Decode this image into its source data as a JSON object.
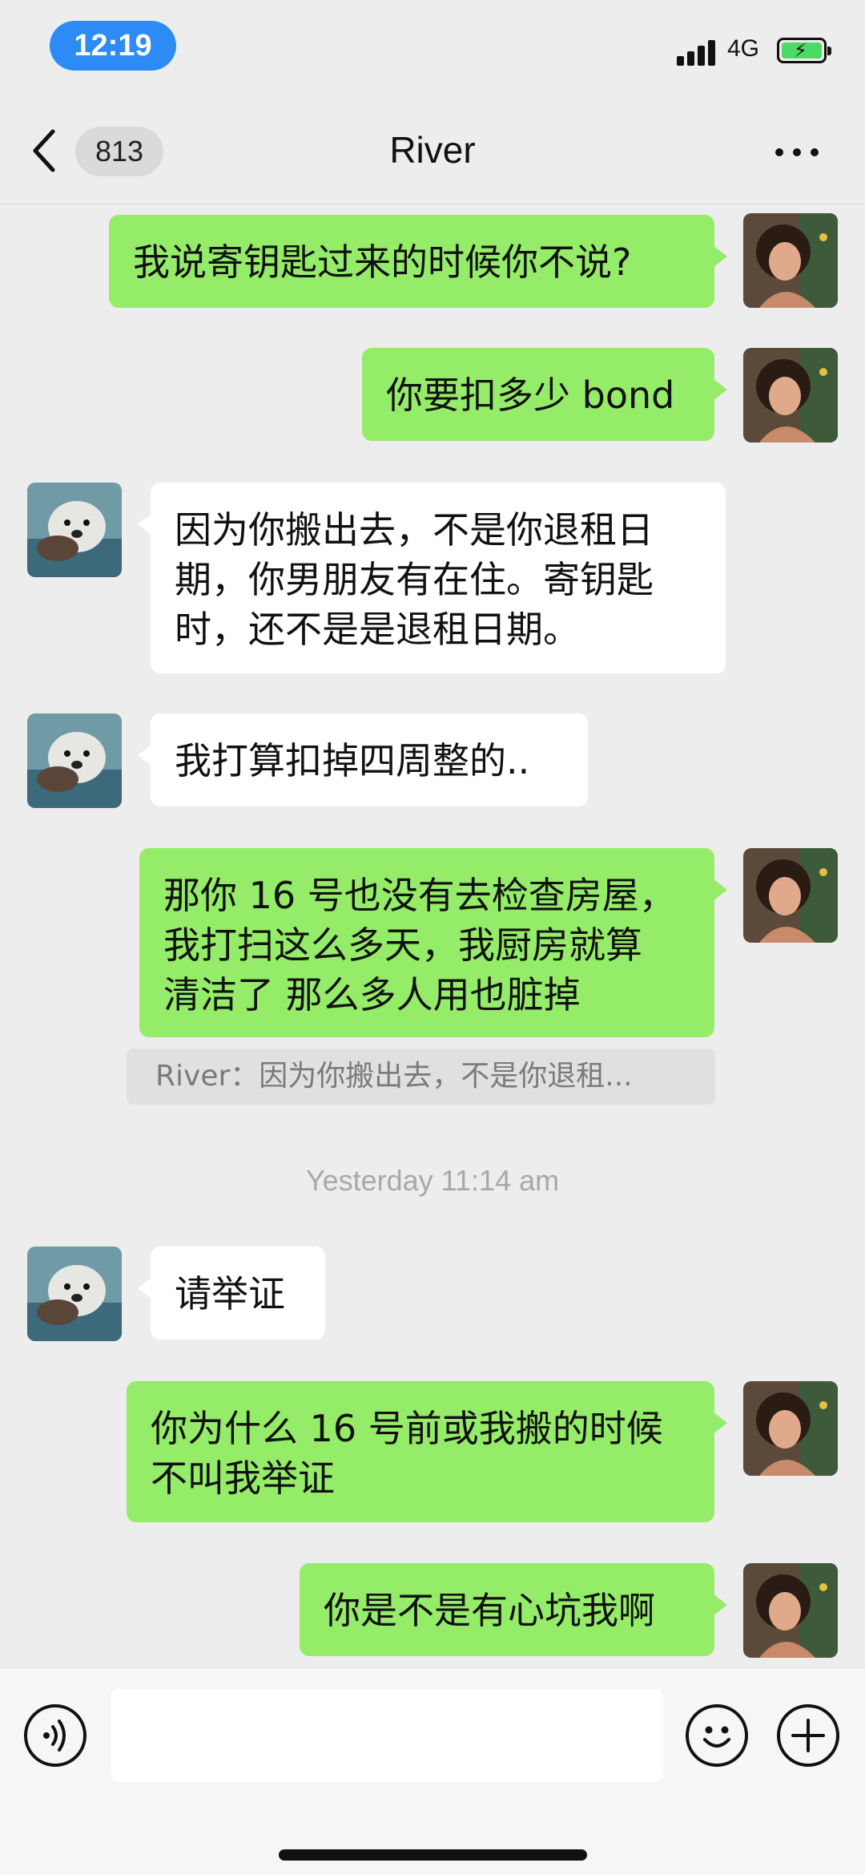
{
  "status_bar": {
    "time": "12:19",
    "network": "4G"
  },
  "nav": {
    "unread_count": "813",
    "title": "River"
  },
  "messages": [
    {
      "direction": "out",
      "text": "我说寄钥匙过来的时候你不说?"
    },
    {
      "direction": "out",
      "text": "你要扣多少 bond"
    },
    {
      "direction": "in",
      "lines": [
        "因为你搬出去，不是你退租日",
        "期，你男朋友有在住。寄钥匙",
        "时，还不是是退租日期。"
      ]
    },
    {
      "direction": "in",
      "text": "我打算扣掉四周整的.."
    },
    {
      "direction": "out",
      "lines": [
        "那你 16 号也没有去检查房屋，",
        "我打扫这么多天，我厨房就算",
        "清洁了 那么多人用也脏掉"
      ]
    },
    {
      "direction": "in",
      "text": "请举证"
    },
    {
      "direction": "out",
      "lines": [
        "你为什么 16 号前或我搬的时候",
        "不叫我举证"
      ]
    },
    {
      "direction": "out",
      "text": "你是不是有心坑我啊"
    }
  ],
  "quote": "River：因为你搬出去，不是你退租...",
  "timestamp": "Yesterday 11:14 am",
  "input": {
    "placeholder": ""
  },
  "icons": {
    "voice": "voice-icon",
    "emoji": "emoji-icon",
    "plus": "plus-icon",
    "back": "chevron-left-icon",
    "more": "more-icon"
  },
  "colors": {
    "outgoing_bubble": "#95ec69",
    "incoming_bubble": "#ffffff",
    "background": "#ededed",
    "time_pill": "#2d8bf5"
  }
}
